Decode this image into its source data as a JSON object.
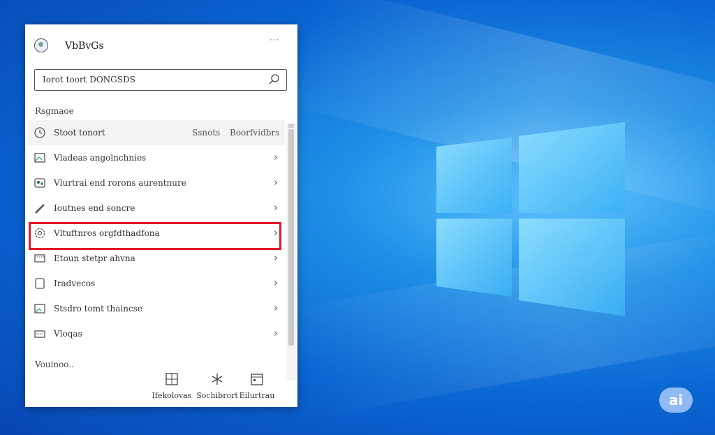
{
  "start_menu": {
    "username": "VbBvGs",
    "more_label": "···",
    "search": {
      "value": "Iorot toort DONGSDS"
    },
    "section_title": "Rsgmaoe",
    "items": [
      {
        "label": "Stoot tonort",
        "extra1": "Ssnots",
        "extra2": "Boorfvidbrs",
        "icon": "clock-icon"
      },
      {
        "label": "Vladeas angolnchnies",
        "icon": "image-icon"
      },
      {
        "label": "Vlurtrai end rorons aurentnure",
        "icon": "people-icon"
      },
      {
        "label": "Ioutnes end soncre",
        "icon": "pen-icon"
      },
      {
        "label": "Vltuftnros orgfdthadfona",
        "icon": "gear-icon"
      },
      {
        "label": "Etoun stetpr ahvna",
        "icon": "film-icon"
      },
      {
        "label": "Iradvecos",
        "icon": "document-icon"
      },
      {
        "label": "Stsdro tomt thaincse",
        "icon": "photo-icon"
      },
      {
        "label": "Vloqas",
        "icon": "keyboard-icon"
      }
    ],
    "footer_title": "Vouinoo..",
    "footer_buttons": [
      {
        "label": "Ifekolovas",
        "icon": "grid-icon"
      },
      {
        "label": "Sochibrort",
        "icon": "sparkle-icon"
      },
      {
        "label": "Eilurtrau",
        "icon": "calendar-icon"
      }
    ]
  },
  "desktop": {
    "badge": "ai",
    "accent": "#e3192b",
    "background": "#0a66d2"
  }
}
